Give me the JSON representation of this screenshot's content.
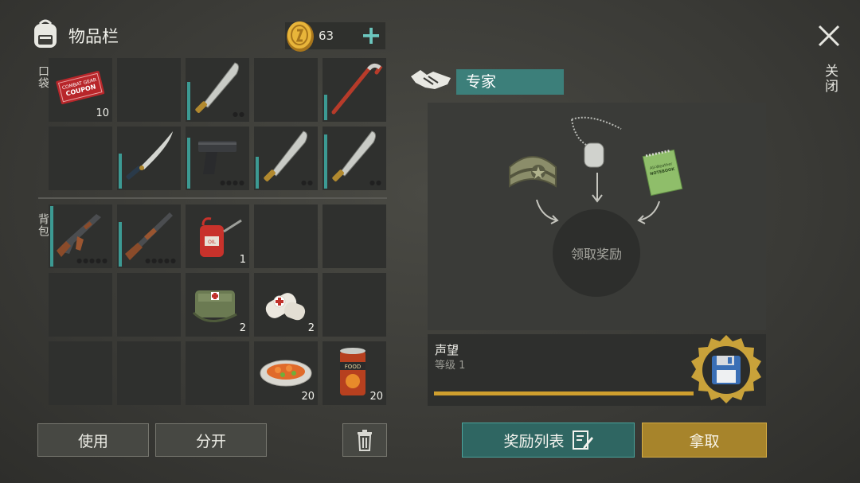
{
  "inventory": {
    "title": "物品栏",
    "coins": "63",
    "pocket_label": "口袋",
    "backpack_label": "背包",
    "pocket_slots": [
      {
        "item": "combat-gear-coupon",
        "count": "10",
        "coupon_text_1": "COMBAT GEAR",
        "coupon_text_2": "COUPON"
      },
      {
        "item": "empty"
      },
      {
        "item": "machete",
        "durability": 0.6
      },
      {
        "item": "empty"
      },
      {
        "item": "crowbar",
        "durability": 0.4
      },
      {
        "item": "empty"
      },
      {
        "item": "katana",
        "durability": 0.55
      },
      {
        "item": "pistol",
        "durability": 0.8
      },
      {
        "item": "machete",
        "durability": 0.5
      },
      {
        "item": "machete",
        "durability": 0.85
      }
    ],
    "backpack_slots": [
      {
        "item": "ak-rifle",
        "durability": 0.95
      },
      {
        "item": "shotgun",
        "durability": 0.7
      },
      {
        "item": "oil-can",
        "count": "1",
        "can_text": "OIL"
      },
      {
        "item": "empty"
      },
      {
        "item": "empty"
      },
      {
        "item": "empty"
      },
      {
        "item": "empty"
      },
      {
        "item": "first-aid-bag",
        "count": "2"
      },
      {
        "item": "bandage",
        "count": "2"
      },
      {
        "item": "empty"
      },
      {
        "item": "empty"
      },
      {
        "item": "empty"
      },
      {
        "item": "empty"
      },
      {
        "item": "salad-plate",
        "count": "20"
      },
      {
        "item": "canned-food",
        "count": "20",
        "can_text": "FOOD"
      }
    ],
    "buttons": {
      "use": "使用",
      "split": "分开"
    }
  },
  "expert": {
    "title": "专家",
    "claim_label": "领取奖励",
    "notebook_text_1": "All-Weather",
    "notebook_text_2": "NOTEBOOK",
    "reputation_title": "声望",
    "reputation_level": "等级 1",
    "reputation_progress": 0.99,
    "reward_list_button": "奖励列表",
    "take_button": "拿取"
  },
  "close_label": "关闭",
  "colors": {
    "accent_teal": "#3c7f7a",
    "accent_gold": "#cf9f2e",
    "durability": "#3c9a93"
  }
}
